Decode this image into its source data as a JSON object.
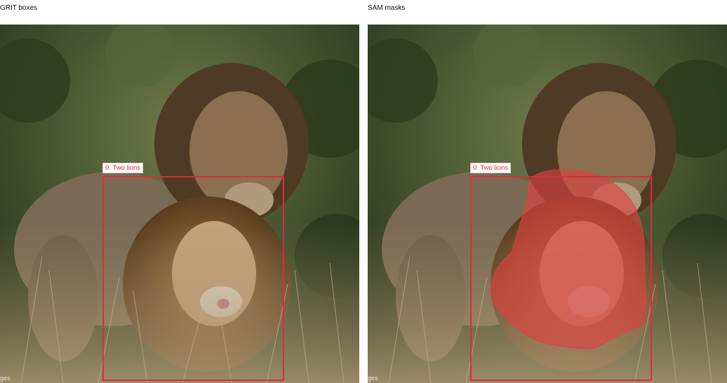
{
  "panels": [
    {
      "title": "GRIT boxes",
      "watermark": "ges",
      "detections": [
        {
          "label": "0: Two lions"
        }
      ]
    },
    {
      "title": "SAM masks",
      "watermark": "ges",
      "detections": [
        {
          "label": "0: Two lions"
        }
      ],
      "mask_color": "#d6303a"
    }
  ],
  "colors": {
    "box": "#d6303a",
    "label_text": "#d6303a",
    "background": "#ffffff"
  }
}
